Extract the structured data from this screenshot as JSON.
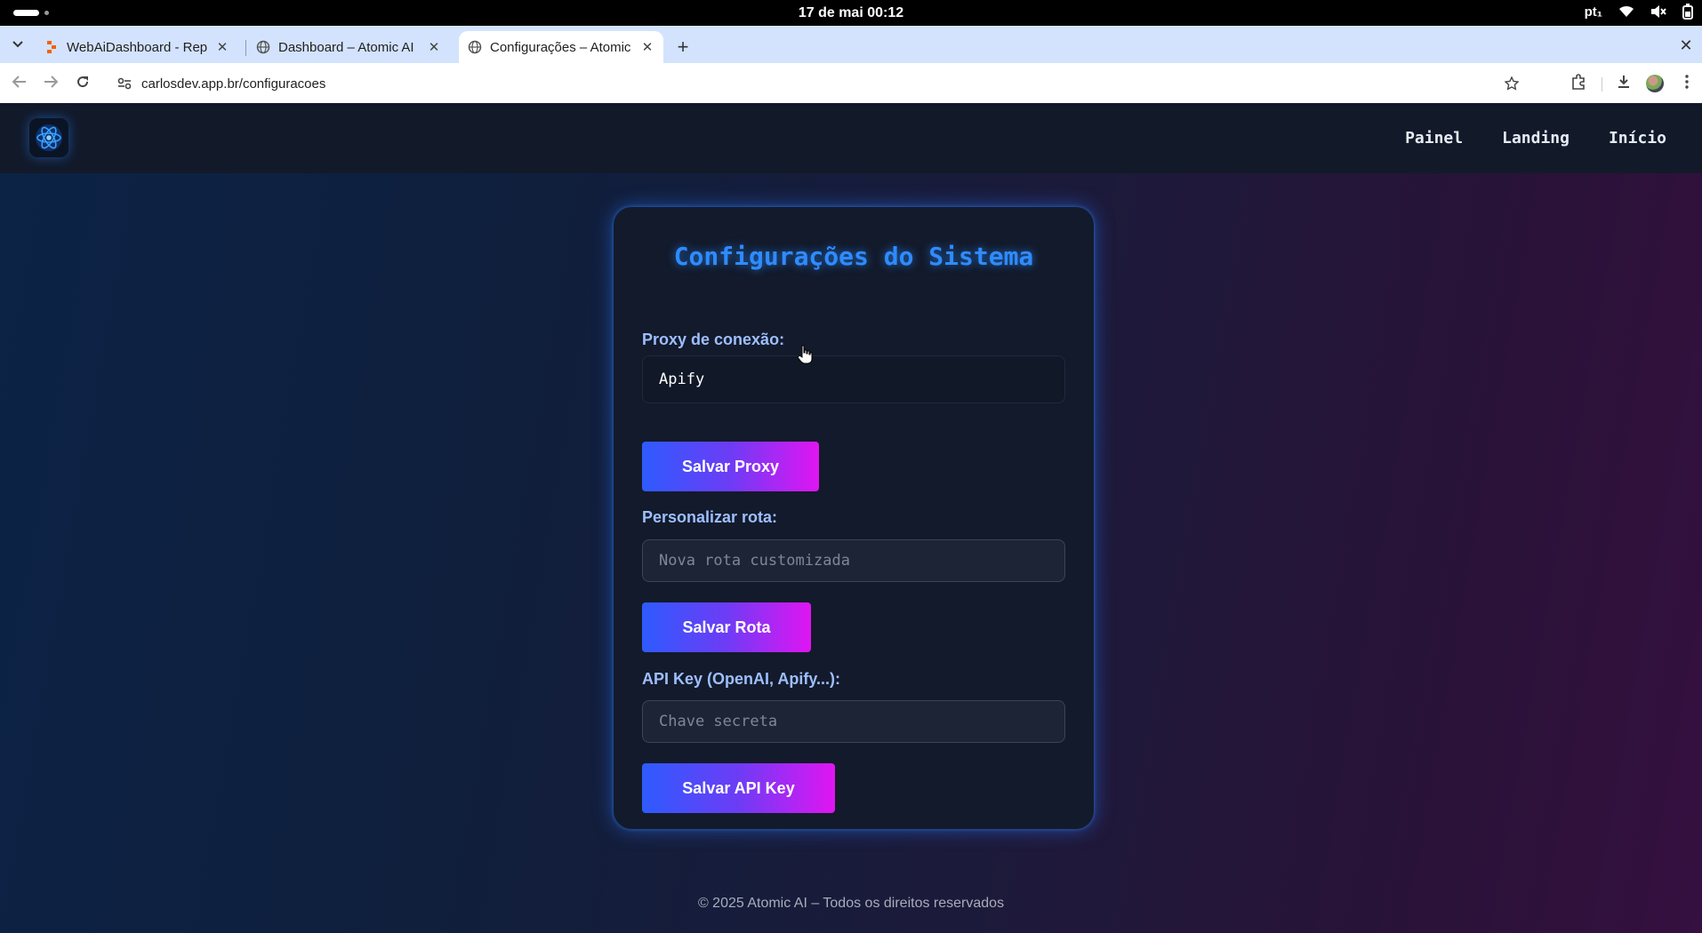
{
  "os": {
    "clock": "17 de mai  00:12",
    "lang": "pt₁"
  },
  "tabs": [
    {
      "title": "WebAiDashboard - Rep",
      "icon": "replit-icon"
    },
    {
      "title": "Dashboard – Atomic AI",
      "icon": "globe-icon"
    },
    {
      "title": "Configurações – Atomic",
      "icon": "globe-icon",
      "active": true
    }
  ],
  "address_bar": {
    "url": "carlosdev.app.br/configuracoes"
  },
  "nav": {
    "links": [
      "Painel",
      "Landing",
      "Início"
    ]
  },
  "card": {
    "title": "Configurações do Sistema",
    "proxy": {
      "label": "Proxy de conexão:",
      "value": "Apify",
      "button": "Salvar Proxy"
    },
    "route": {
      "label": "Personalizar rota:",
      "placeholder": "Nova rota customizada",
      "button": "Salvar Rota"
    },
    "apikey": {
      "label": "API Key (OpenAI, Apify...):",
      "placeholder": "Chave secreta",
      "button": "Salvar API Key"
    }
  },
  "footer": {
    "text": "© 2025 Atomic AI – Todos os direitos reservados"
  },
  "colors": {
    "accent_start": "#2e5bff",
    "accent_end": "#e015f2",
    "title": "#2f8bff",
    "label": "#9dbfff"
  }
}
